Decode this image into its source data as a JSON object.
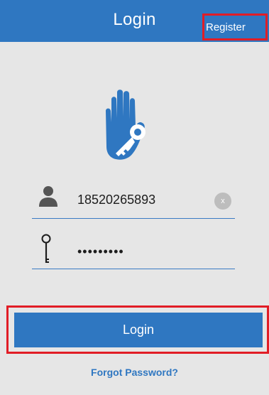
{
  "header": {
    "title": "Login",
    "register_label": "Register"
  },
  "logo": {
    "icon": "hand-key-icon"
  },
  "form": {
    "phone_icon": "user-icon",
    "phone_value": "18520265893",
    "clear_label": "x",
    "password_icon": "key-icon",
    "password_value": "•••••••••"
  },
  "actions": {
    "login_label": "Login",
    "forgot_label": "Forgot Password?"
  },
  "colors": {
    "primary": "#2f77c1",
    "highlight_border": "#e11d26",
    "background": "#e6e6e6",
    "icon_dark": "#555555"
  }
}
